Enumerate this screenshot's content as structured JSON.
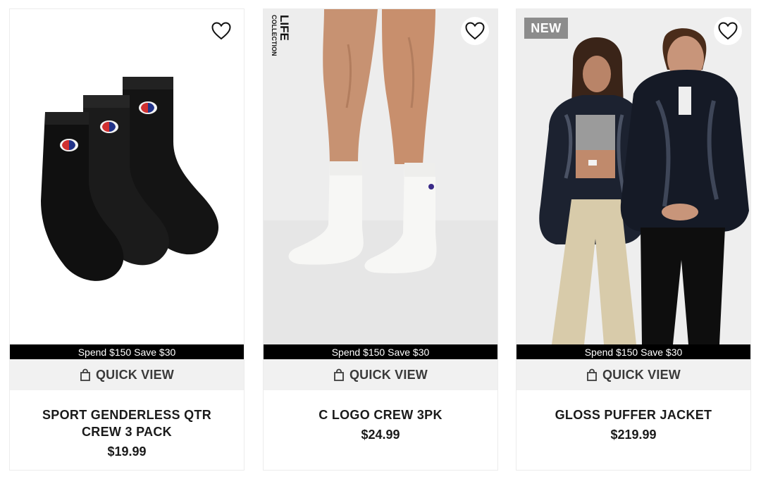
{
  "products": [
    {
      "name": "SPORT GENDERLESS QTR CREW 3 PACK",
      "price": "$19.99",
      "promo": "Spend $150 Save $30",
      "quick_view": "QUICK VIEW",
      "wishlist_icon": "heart-outline-icon"
    },
    {
      "name": "C LOGO CREW 3PK",
      "price": "$24.99",
      "promo": "Spend $150 Save $30",
      "quick_view": "QUICK VIEW",
      "collection_label": "LIFE COLLECTION",
      "wishlist_icon": "heart-outline-icon"
    },
    {
      "name": "GLOSS PUFFER JACKET",
      "price": "$219.99",
      "promo": "Spend $150 Save $30",
      "quick_view": "QUICK VIEW",
      "badge": "NEW",
      "wishlist_icon": "heart-outline-icon"
    }
  ],
  "colors": {
    "promo_bar": "#000000",
    "quick_view_bg": "#f1f1f1",
    "badge_bg": "#8c8c8c"
  }
}
